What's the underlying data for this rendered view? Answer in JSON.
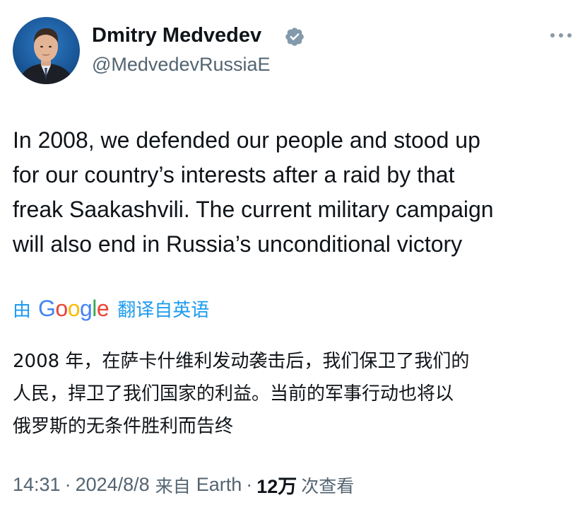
{
  "author": {
    "display_name": "Dmitry Medvedev",
    "handle": "@MedvedevRussiaE",
    "verified": true,
    "verified_badge_color": "#829aab"
  },
  "tweet": {
    "text_lines": [
      "In 2008, we defended our people and stood up",
      "for our country’s interests after a raid by that",
      "freak Saakashvili. The current military campaign",
      "will also end in Russia’s unconditional victory"
    ]
  },
  "translation": {
    "prefix": "由",
    "provider_letters": [
      {
        "char": "G",
        "color": "#4285f4"
      },
      {
        "char": "o",
        "color": "#ea4335"
      },
      {
        "char": "o",
        "color": "#fbbc05"
      },
      {
        "char": "g",
        "color": "#4285f4"
      },
      {
        "char": "l",
        "color": "#34a853"
      },
      {
        "char": "e",
        "color": "#ea4335"
      }
    ],
    "suffix": "翻译自英语",
    "link_color": "#1d9bf0",
    "text_lines": [
      "2008 年，在萨卡什维利发动袭击后，我们保卫了我们的",
      "人民，捍卫了我们国家的利益。当前的军事行动也将以",
      "俄罗斯的无条件胜利而告终"
    ]
  },
  "meta": {
    "time": "14:31",
    "date": "2024/8/8",
    "source_prefix": "来自",
    "source": "Earth",
    "views_count": "12万",
    "views_label": "次查看",
    "separator": "·"
  },
  "icons": {
    "avatar": "profile-photo",
    "verified": "verified-badge-icon",
    "more": "more-options-icon"
  }
}
